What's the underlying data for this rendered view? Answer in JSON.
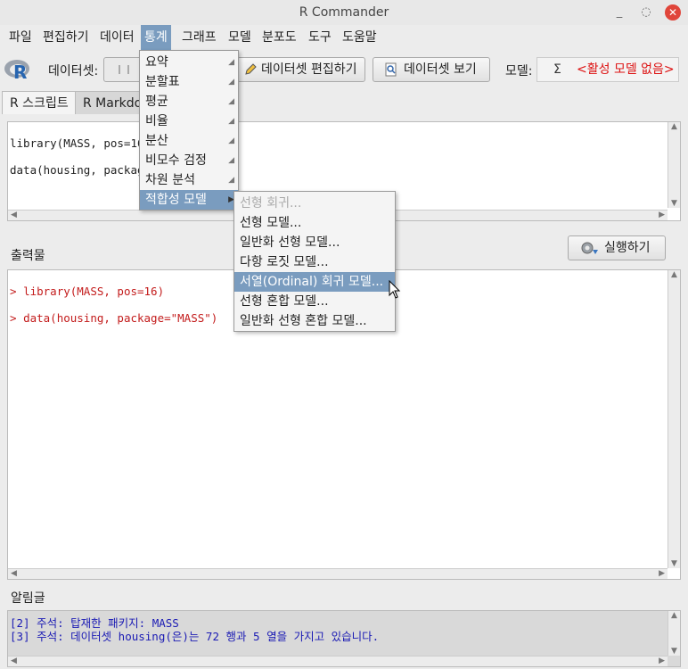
{
  "window": {
    "title": "R Commander",
    "minimize": "_",
    "restore": "◌",
    "close": "✕"
  },
  "menubar": {
    "file": "파일",
    "edit": "편집하기",
    "data": "데이터",
    "statistics": "통계",
    "graphs": "그래프",
    "models": "모델",
    "distributions": "분포도",
    "tools": "도구",
    "help": "도움말"
  },
  "toolbar": {
    "dataset_label": "데이터셋:",
    "edit_dataset": "데이터셋 편집하기",
    "view_dataset": "데이터셋 보기",
    "model_label": "모델:",
    "model_sigma": "Σ",
    "model_value": "<활성 모델 없음>"
  },
  "tabs": {
    "script": "R 스크립트",
    "markdown": "R Markdown"
  },
  "script_lines": [
    "library(MASS, pos=16)",
    "data(housing, package"
  ],
  "output": {
    "label": "출력물",
    "run_button": "실행하기",
    "prompt": ">",
    "lines": [
      "library(MASS, pos=16)",
      "data(housing, package=\"MASS\")"
    ]
  },
  "messages": {
    "label": "알림글",
    "lines": [
      "[2] 주석: 탑재한 패키지: MASS",
      "[3] 주석: 데이터셋 housing(은)는 72 행과 5 열을 가지고 있습니다."
    ]
  },
  "stats_menu": {
    "items": [
      "요약",
      "분할표",
      "평균",
      "비율",
      "분산",
      "비모수 검정",
      "차원 분석",
      "적합성 모델"
    ],
    "active_index": 7
  },
  "fit_menu": {
    "items": [
      "선형 회귀...",
      "선형 모델...",
      "일반화 선형 모델...",
      "다항 로짓 모델...",
      "서열(Ordinal) 회귀 모델...",
      "선형 혼합 모델...",
      "일반화 선형 혼합 모델..."
    ],
    "disabled_index": 0,
    "active_index": 4
  },
  "colors": {
    "menu_highlight": "#7a9cbf",
    "output_text": "#c31c1c",
    "message_text": "#1a1ab4",
    "no_model_text": "#dd1111"
  }
}
